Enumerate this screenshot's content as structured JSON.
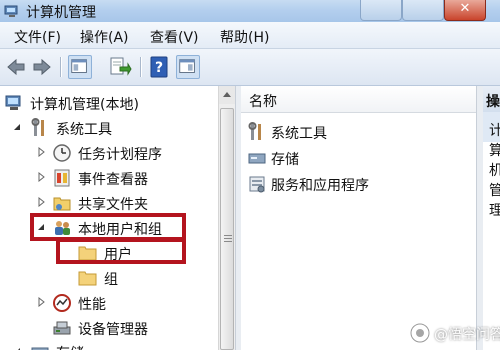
{
  "window": {
    "title": "计算机管理"
  },
  "menu": [
    {
      "label": "文件(F)"
    },
    {
      "label": "操作(A)"
    },
    {
      "label": "查看(V)"
    },
    {
      "label": "帮助(H)"
    }
  ],
  "toolbar": {
    "icons": [
      "back-arrow-icon",
      "forward-arrow-icon",
      "show-console-tree-icon",
      "export-list-icon",
      "help-icon",
      "show-action-pane-icon"
    ]
  },
  "tree": {
    "root": "计算机管理(本地)",
    "items": [
      {
        "label": "系统工具",
        "icon": "tools-icon"
      },
      {
        "label": "任务计划程序",
        "icon": "clock-icon"
      },
      {
        "label": "事件查看器",
        "icon": "event-viewer-icon"
      },
      {
        "label": "共享文件夹",
        "icon": "shared-folder-icon"
      },
      {
        "label": "本地用户和组",
        "icon": "users-group-icon"
      },
      {
        "label": "用户",
        "icon": "folder-icon"
      },
      {
        "label": "组",
        "icon": "folder-icon"
      },
      {
        "label": "性能",
        "icon": "performance-icon"
      },
      {
        "label": "设备管理器",
        "icon": "device-manager-icon"
      },
      {
        "label": "存储",
        "icon": "storage-icon"
      }
    ]
  },
  "list": {
    "column_header": "名称",
    "items": [
      {
        "label": "系统工具",
        "icon": "tools-icon"
      },
      {
        "label": "存储",
        "icon": "storage-icon"
      },
      {
        "label": "服务和应用程序",
        "icon": "services-icon"
      }
    ]
  },
  "actions": {
    "header": "操作",
    "first_item": "计算机管理"
  },
  "watermark": {
    "text": "@悟空问答"
  },
  "colors": {
    "highlight": "#b4141e",
    "titlebar": "#b4cfee"
  }
}
